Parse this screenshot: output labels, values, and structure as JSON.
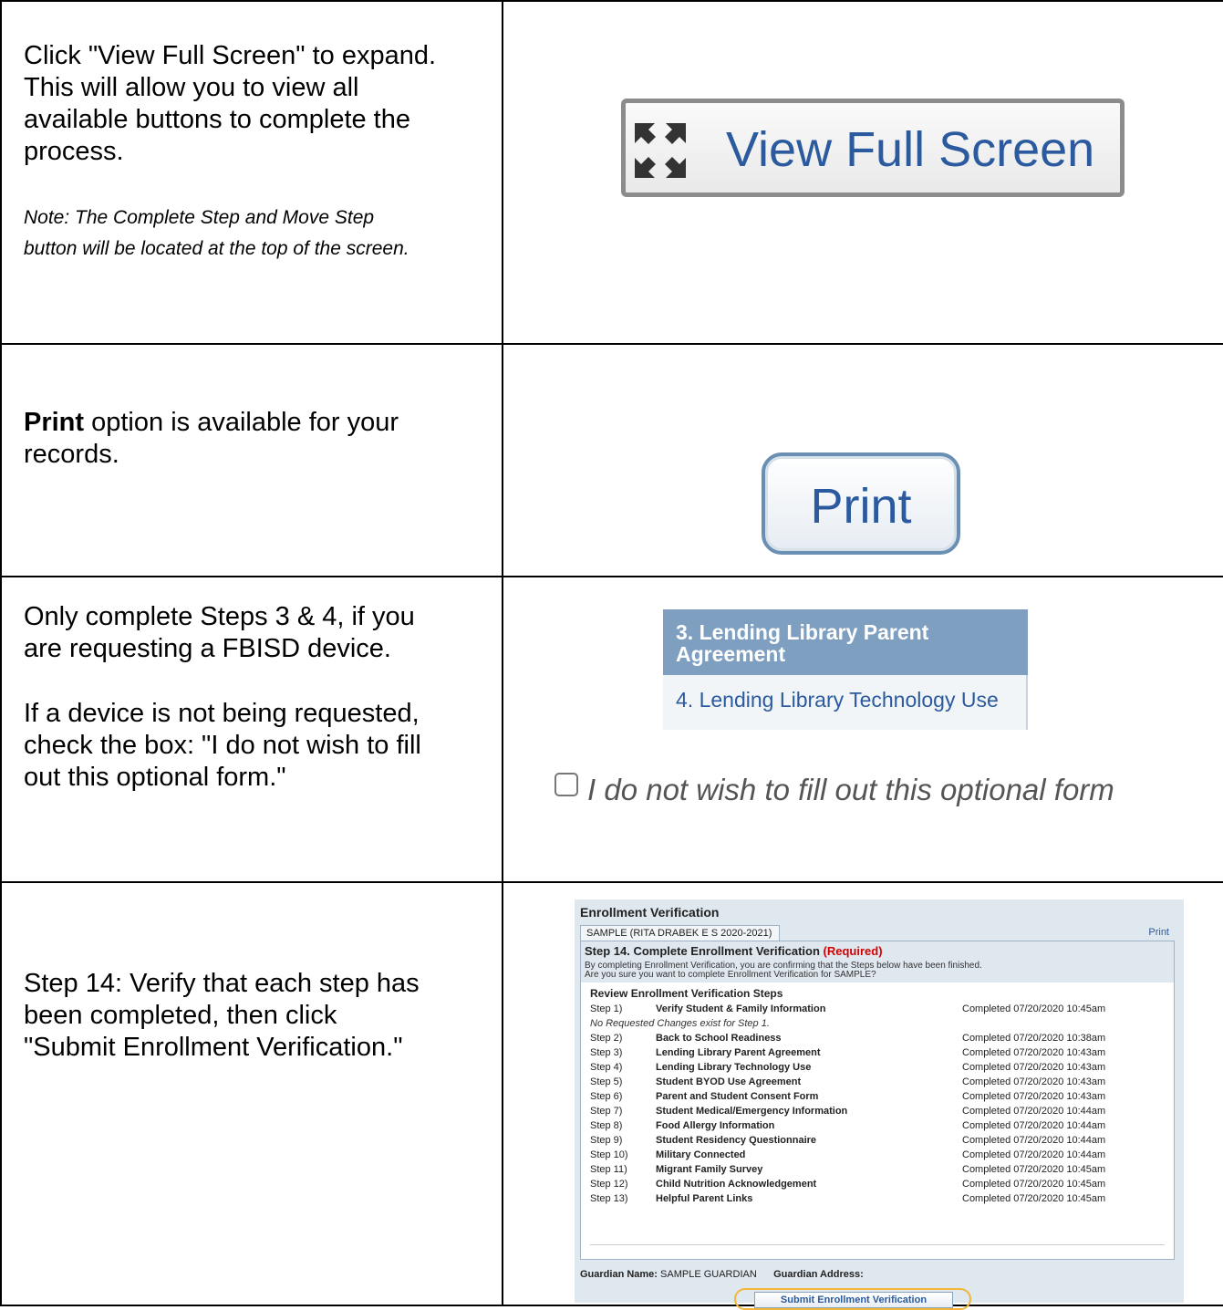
{
  "rows": [
    {
      "left": {
        "lines": [
          "Click \"View Full Screen\" to expand.",
          "This will allow you to view all",
          "available buttons to complete the",
          "process."
        ],
        "note_lines": [
          "Note:  The Complete Step and Move Step",
          "button will be located at the top of the screen."
        ]
      },
      "right": {
        "button_label": "View Full Screen",
        "icon": "expand-arrows-icon"
      }
    },
    {
      "left": {
        "bold": "Print",
        "rest_line1": " option is available for your",
        "line2": "records."
      },
      "right": {
        "button_label": "Print"
      }
    },
    {
      "left": {
        "lines": [
          "Only complete Steps 3 & 4, if you",
          "are requesting a FBISD device."
        ],
        "lines2": [
          "If a device is not being requested,",
          "check the box: \"I do not wish to fill",
          "out this optional form.\""
        ]
      },
      "right": {
        "nav_item_active": "3. Lending Library Parent Agreement",
        "nav_item": "4. Lending Library Technology Use",
        "optional_label": "I do not wish to fill out this optional form"
      }
    },
    {
      "left": {
        "lines": [
          "Step 14:  Verify that each step has",
          "been completed, then click",
          "\"Submit Enrollment Verification.\""
        ]
      },
      "right": {
        "title": "Enrollment Verification",
        "tab": "SAMPLE (RITA DRABEK E S 2020-2021)",
        "print": "Print",
        "step_title": "Step 14. Complete Enrollment Verification",
        "required": "(Required)",
        "confirm_line1": "By completing Enrollment Verification, you are confirming that the Steps below have been finished.",
        "confirm_line2": "Are you sure you want to complete Enrollment Verification for SAMPLE?",
        "review_title": "Review Enrollment Verification Steps",
        "no_changes": "No Requested Changes exist for Step 1.",
        "steps": [
          {
            "num": "Step 1)",
            "name": "Verify Student & Family Information",
            "status": "Completed 07/20/2020 10:45am"
          },
          {
            "num": "Step 2)",
            "name": "Back to School Readiness",
            "status": "Completed 07/20/2020 10:38am"
          },
          {
            "num": "Step 3)",
            "name": "Lending Library Parent Agreement",
            "status": "Completed 07/20/2020 10:43am"
          },
          {
            "num": "Step 4)",
            "name": "Lending Library Technology Use",
            "status": "Completed 07/20/2020 10:43am"
          },
          {
            "num": "Step 5)",
            "name": "Student BYOD Use Agreement",
            "status": "Completed 07/20/2020 10:43am"
          },
          {
            "num": "Step 6)",
            "name": "Parent and Student Consent Form",
            "status": "Completed 07/20/2020 10:43am"
          },
          {
            "num": "Step 7)",
            "name": "Student Medical/Emergency Information",
            "status": "Completed 07/20/2020 10:44am"
          },
          {
            "num": "Step 8)",
            "name": "Food Allergy Information",
            "status": "Completed 07/20/2020 10:44am"
          },
          {
            "num": "Step 9)",
            "name": "Student Residency Questionnaire",
            "status": "Completed 07/20/2020 10:44am"
          },
          {
            "num": "Step 10)",
            "name": "Military Connected",
            "status": "Completed 07/20/2020 10:44am"
          },
          {
            "num": "Step 11)",
            "name": "Migrant Family Survey",
            "status": "Completed 07/20/2020 10:45am"
          },
          {
            "num": "Step 12)",
            "name": "Child Nutrition Acknowledgement",
            "status": "Completed 07/20/2020 10:45am"
          },
          {
            "num": "Step 13)",
            "name": "Helpful Parent Links",
            "status": "Completed 07/20/2020 10:45am"
          }
        ],
        "guardian_name_label": "Guardian Name:",
        "guardian_name": "SAMPLE GUARDIAN",
        "guardian_address_label": "Guardian Address:",
        "submit": "Submit Enrollment Verification"
      }
    }
  ]
}
